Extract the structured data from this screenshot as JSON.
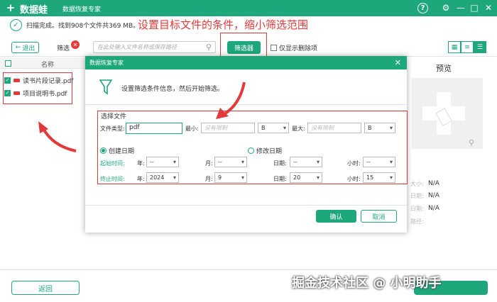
{
  "app": {
    "brand": "数据蛙",
    "subtitle": "数据恢复专家",
    "logo": "+"
  },
  "window_buttons": {
    "help": "?",
    "settings": "⚙",
    "minimize": "—",
    "maximize": "□",
    "close": "✕"
  },
  "status": {
    "check": "✓",
    "text": "扫描完成。找到908个文件共369 MB。"
  },
  "annotation_top": "设置目标文件的条件，缩小筛选范围",
  "toolbar": {
    "back_small": "退出",
    "back_arrow": "←",
    "filter_label": "筛选",
    "filter_clear": "✕",
    "search_placeholder": "在此处输入文件名称或保存路径",
    "search_icon": "⚲",
    "filter_button": "筛选器",
    "show_deleted": "仅显示删除项",
    "view_modes": [
      "▦",
      "≡",
      "☰"
    ]
  },
  "list": {
    "header_name": "名称",
    "files": [
      {
        "name": "读书片段记录.pdf",
        "checked": "✓"
      },
      {
        "name": "项目说明书.pdf",
        "checked": "✓"
      }
    ]
  },
  "preview": {
    "title": "预览",
    "zoom_icon": "⚲",
    "placeholder_icon": "✚"
  },
  "meta": [
    {
      "label": "大小:",
      "value": "N/A"
    },
    {
      "label": "日期:",
      "value": "N/A"
    },
    {
      "label": "日期:",
      "value": "N/A"
    },
    {
      "label": "路径:",
      "value": ""
    }
  ],
  "bottom": {
    "back_button": "返回"
  },
  "watermark": "掘金技术社区 @ 小明助手",
  "dialog": {
    "title": "数据恢复专家",
    "close": "✕",
    "message": "设置筛选条件信息，然后开始筛选。",
    "section_title": "选择文件",
    "file_type_label": "文件类型:",
    "file_type_value": "pdf",
    "min_label": "最小:",
    "min_placeholder": "没有限制",
    "min_unit": "B",
    "max_label": "最大:",
    "max_placeholder": "没有限制",
    "max_unit": "B",
    "created_date": "创建日期",
    "modified_date": "修改日期",
    "start_label": "起始时间:",
    "end_label": "终止时间:",
    "year_label": "年:",
    "month_label": "月:",
    "day_label": "日期:",
    "hour_label": "小时:",
    "start": {
      "year": "--",
      "month": "--",
      "day": "--",
      "hour": "--"
    },
    "end": {
      "year": "2024",
      "month": "9",
      "day": "20",
      "hour": "15"
    },
    "ok": "确认",
    "cancel": "取消"
  },
  "colors": {
    "accent": "#1fa77c",
    "annotation": "#e23a3a"
  }
}
